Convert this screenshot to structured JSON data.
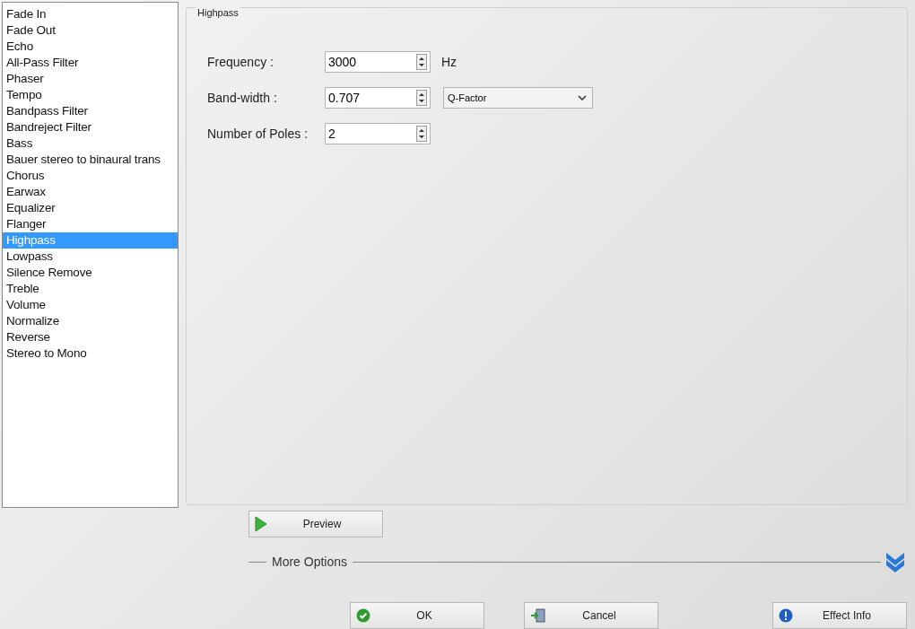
{
  "effects": [
    {
      "label": "Fade In",
      "selected": false
    },
    {
      "label": "Fade Out",
      "selected": false
    },
    {
      "label": "Echo",
      "selected": false
    },
    {
      "label": "All-Pass Filter",
      "selected": false
    },
    {
      "label": "Phaser",
      "selected": false
    },
    {
      "label": "Tempo",
      "selected": false
    },
    {
      "label": "Bandpass Filter",
      "selected": false
    },
    {
      "label": "Bandreject Filter",
      "selected": false
    },
    {
      "label": "Bass",
      "selected": false
    },
    {
      "label": "Bauer stereo to binaural trans",
      "selected": false
    },
    {
      "label": "Chorus",
      "selected": false
    },
    {
      "label": "Earwax",
      "selected": false
    },
    {
      "label": "Equalizer",
      "selected": false
    },
    {
      "label": "Flanger",
      "selected": false
    },
    {
      "label": "Highpass",
      "selected": true
    },
    {
      "label": "Lowpass",
      "selected": false
    },
    {
      "label": "Silence Remove",
      "selected": false
    },
    {
      "label": "Treble",
      "selected": false
    },
    {
      "label": "Volume",
      "selected": false
    },
    {
      "label": "Normalize",
      "selected": false
    },
    {
      "label": "Reverse",
      "selected": false
    },
    {
      "label": "Stereo to Mono",
      "selected": false
    }
  ],
  "panel": {
    "title": "Highpass",
    "fields": [
      {
        "label": "Frequency :",
        "value": "3000",
        "kind": "unit",
        "unit": "Hz"
      },
      {
        "label": "Band-width :",
        "value": "0.707",
        "kind": "select",
        "option": "Q-Factor"
      },
      {
        "label": "Number of Poles :",
        "value": "2",
        "kind": "plain"
      }
    ]
  },
  "preview": "Preview",
  "more_options": "More Options",
  "buttons": [
    {
      "label": "OK",
      "kind": "ok"
    },
    {
      "label": "Cancel",
      "kind": "cancel"
    },
    {
      "label": "Effect Info",
      "kind": "info"
    }
  ]
}
